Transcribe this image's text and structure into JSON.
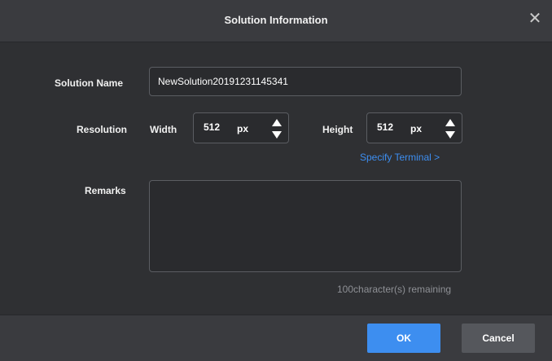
{
  "dialog": {
    "title": "Solution Information",
    "close_icon": "close-icon"
  },
  "form": {
    "solution_name_label": "Solution Name",
    "solution_name_value": "NewSolution20191231145341",
    "resolution_label": "Resolution",
    "width_label": "Width",
    "width_value": "512",
    "width_unit": "px",
    "height_label": "Height",
    "height_value": "512",
    "height_unit": "px",
    "specify_terminal_link": "Specify Terminal  >",
    "remarks_label": "Remarks",
    "remarks_value": "",
    "chars_remaining": "100character(s) remaining"
  },
  "buttons": {
    "ok_label": "OK",
    "cancel_label": "Cancel"
  },
  "colors": {
    "accent": "#3d8ef0",
    "background": "#2f3033",
    "panel": "#3a3b3f"
  }
}
